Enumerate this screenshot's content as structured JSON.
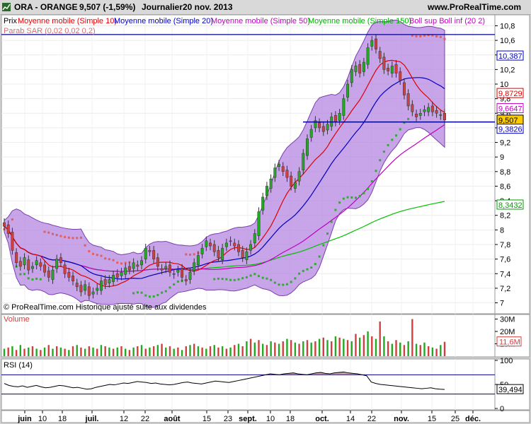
{
  "header": {
    "ticker": "ORA - ORANGE",
    "price": "9,507 (-1,59%)",
    "period": "Journalier",
    "date": "20 nov. 2013",
    "site": "www.ProRealTime.com"
  },
  "legend": {
    "prix": "Prix",
    "ma10": "Moyenne mobile (Simple 10)",
    "ma20": "Moyenne mobile (Simple 20)",
    "ma50": "Moyenne mobile (Simple 50)",
    "ma150": "Moyenne mobile (Simple 150)",
    "boll": "Boll sup Boll inf (20 2)",
    "sar": "Parab SAR (0,02 0,02 0,2)"
  },
  "footer_note": "© ProRealTime.com  Historique ajusté suite aux dividendes",
  "panels": {
    "volume_label": "Volume",
    "rsi_label": "RSI (14)"
  },
  "colors": {
    "bull": "#22aa22",
    "bear": "#d04040",
    "ma10": "#e00000",
    "ma20": "#0000c0",
    "ma50": "#c000c0",
    "ma150": "#00c000",
    "boll_fill": "#b07ee0",
    "sar": "#e06060",
    "sar_up": "#33aa33",
    "hline": "#000090"
  },
  "chart_data": [
    {
      "type": "candlestick",
      "title": "ORA - ORANGE",
      "ylim": [
        6.85,
        10.95
      ],
      "y_ticks": [
        "10,8",
        "10,6",
        "10,4",
        "10,2",
        "10",
        "9,8",
        "9,6",
        "9,4",
        "9,2",
        "9",
        "8,8",
        "8,6",
        "8,4",
        "8,2",
        "8",
        "7,8",
        "7,6",
        "7,4",
        "7,2",
        "7"
      ],
      "x_labels": [
        "juin",
        "10",
        "18",
        "juil.",
        "12",
        "22",
        "août",
        "15",
        "23",
        "sept.",
        "10",
        "18",
        "oct.",
        "14",
        "22",
        "nov.",
        "15",
        "25",
        "déc."
      ],
      "price_tags": [
        {
          "label": "10,387",
          "value": 10.387,
          "color": "#0000c0",
          "bg": "#ffffff"
        },
        {
          "label": "9,8729",
          "value": 9.873,
          "color": "#e00000",
          "bg": "#ffffff"
        },
        {
          "label": "9,6647",
          "value": 9.665,
          "color": "#c000c0",
          "bg": "#ffffff"
        },
        {
          "label": "9,507",
          "value": 9.507,
          "color": "#000000",
          "bg": "#ffcc00"
        },
        {
          "label": "9,3826",
          "value": 9.383,
          "color": "#0000c0",
          "bg": "#ffffff"
        },
        {
          "label": "8,3432",
          "value": 8.343,
          "color": "#00a000",
          "bg": "#ffffff"
        }
      ],
      "hlines": [
        10.68,
        9.48
      ],
      "closes": [
        8.05,
        7.95,
        7.72,
        7.55,
        7.5,
        7.62,
        7.45,
        7.5,
        7.58,
        7.5,
        7.42,
        7.35,
        7.45,
        7.6,
        7.55,
        7.4,
        7.35,
        7.3,
        7.22,
        7.15,
        7.25,
        7.1,
        7.15,
        7.2,
        7.3,
        7.25,
        7.32,
        7.38,
        7.35,
        7.42,
        7.48,
        7.45,
        7.55,
        7.5,
        7.58,
        7.75,
        7.7,
        7.6,
        7.5,
        7.45,
        7.5,
        7.42,
        7.4,
        7.45,
        7.35,
        7.3,
        7.42,
        7.55,
        7.65,
        7.75,
        7.85,
        7.78,
        7.7,
        7.62,
        7.75,
        7.82,
        7.85,
        7.78,
        7.7,
        7.62,
        7.7,
        7.8,
        7.95,
        8.25,
        8.45,
        8.6,
        8.7,
        8.85,
        8.9,
        8.8,
        8.72,
        8.6,
        8.65,
        8.8,
        9.05,
        9.25,
        9.38,
        9.5,
        9.4,
        9.35,
        9.45,
        9.55,
        9.48,
        9.6,
        9.8,
        10.0,
        10.2,
        10.25,
        10.15,
        10.3,
        10.5,
        10.6,
        10.48,
        10.35,
        10.2,
        10.18,
        10.25,
        10.15,
        10.05,
        9.85,
        9.7,
        9.62,
        9.55,
        9.6,
        9.65,
        9.68,
        9.62,
        9.6,
        9.58,
        9.507
      ],
      "volume": {
        "unit": "M",
        "y_ticks": [
          "30M",
          "20M",
          "10M"
        ],
        "last_tag": "11,6M",
        "values": [
          6,
          7,
          8,
          5,
          9,
          6,
          7,
          8,
          6,
          5,
          7,
          9,
          6,
          8,
          7,
          6,
          5,
          8,
          9,
          7,
          6,
          8,
          7,
          6,
          9,
          8,
          7,
          6,
          7,
          8,
          6,
          5,
          7,
          8,
          9,
          6,
          7,
          8,
          9,
          10,
          7,
          8,
          6,
          7,
          5,
          8,
          9,
          10,
          8,
          7,
          6,
          8,
          9,
          7,
          8,
          6,
          7,
          9,
          10,
          8,
          12,
          14,
          11,
          13,
          10,
          9,
          12,
          11,
          10,
          12,
          14,
          13,
          11,
          10,
          12,
          13,
          11,
          12,
          14,
          15,
          13,
          12,
          16,
          15,
          14,
          13,
          12,
          18,
          15,
          17,
          20,
          16,
          14,
          28,
          16,
          12,
          10,
          13,
          11,
          9,
          12,
          30,
          10,
          9,
          11,
          8,
          7,
          6,
          9,
          11.6
        ]
      },
      "rsi": {
        "y_ticks": [
          "100",
          "50",
          "0"
        ],
        "levels": [
          70,
          30
        ],
        "last_tag": "39,494",
        "values": [
          52,
          48,
          46,
          45,
          47,
          44,
          46,
          48,
          45,
          43,
          44,
          46,
          48,
          47,
          45,
          43,
          44,
          42,
          40,
          41,
          44,
          46,
          48,
          50,
          49,
          51,
          53,
          52,
          54,
          56,
          55,
          54,
          52,
          53,
          51,
          50,
          49,
          50,
          52,
          54,
          55,
          53,
          52,
          51,
          53,
          55,
          57,
          56,
          55,
          54,
          56,
          58,
          60,
          62,
          64,
          66,
          68,
          70,
          72,
          71,
          70,
          72,
          73,
          74,
          72,
          71,
          70,
          72,
          74,
          75,
          73,
          72,
          74,
          75,
          76,
          74,
          73,
          72,
          70,
          68,
          55,
          52,
          50,
          49,
          48,
          47,
          46,
          45,
          44,
          43,
          42,
          41,
          42,
          43,
          41,
          40,
          39.494
        ]
      }
    }
  ]
}
